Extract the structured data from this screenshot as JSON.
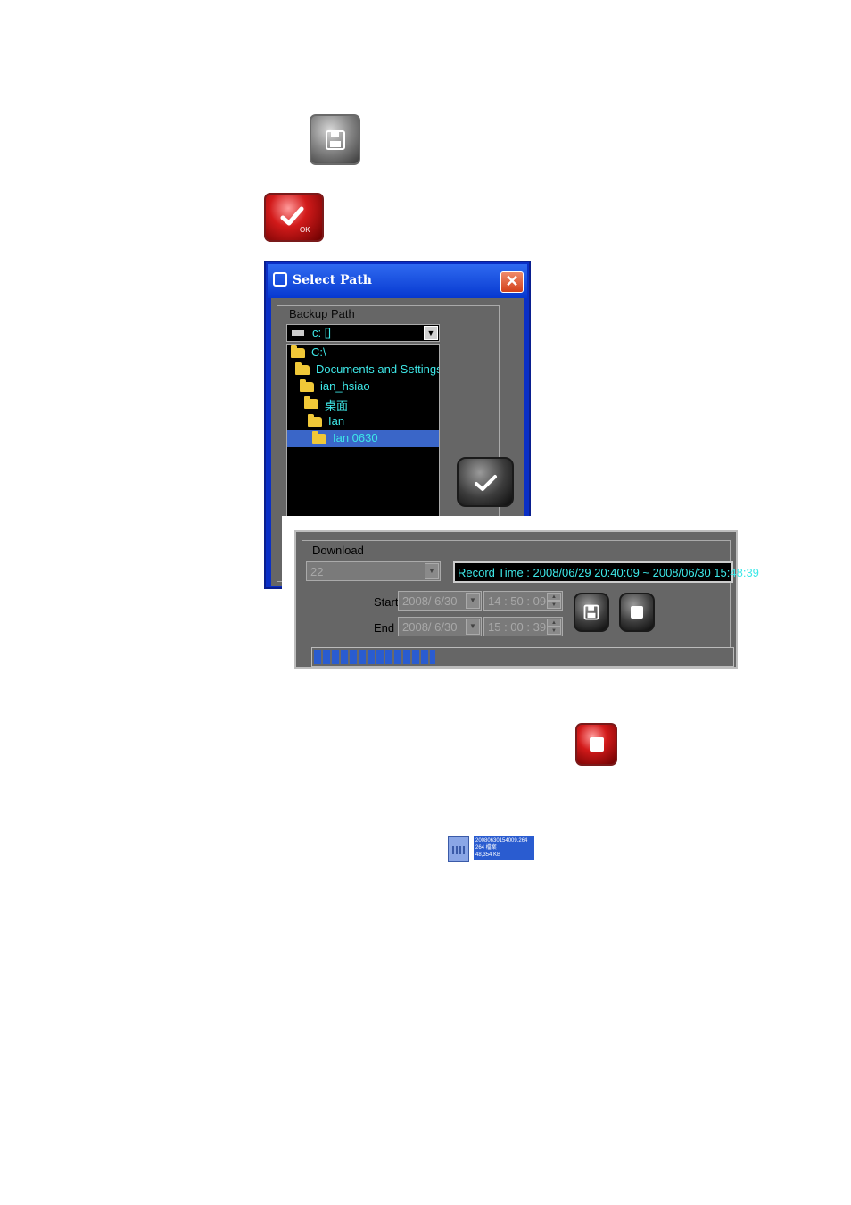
{
  "icons": {
    "save_button": "floppy-disk-icon",
    "ok_button": "checkmark-icon",
    "stop_button": "stop-square-icon"
  },
  "ok_badge": "OK",
  "select_path_dialog": {
    "title": "Select Path",
    "close_glyph": "✕",
    "group_label": "Backup Path",
    "drive_value": "c: []",
    "tree": [
      {
        "label": "C:\\",
        "depth": 0,
        "selected": false
      },
      {
        "label": "Documents and Settings",
        "depth": 1,
        "selected": false
      },
      {
        "label": "ian_hsiao",
        "depth": 2,
        "selected": false
      },
      {
        "label": "桌面",
        "depth": 3,
        "selected": false
      },
      {
        "label": "Ian",
        "depth": 4,
        "selected": false
      },
      {
        "label": "Ian 0630",
        "depth": 5,
        "selected": true
      }
    ]
  },
  "download_panel": {
    "group_label": "Download",
    "channel_value": "22",
    "record_time": "Record Time : 2008/06/29 20:40:09 ~ 2008/06/30 15:48:39",
    "start_label": "Start",
    "start_date": "2008/  6/30",
    "start_time": "14 : 50 : 09",
    "end_label": "End",
    "end_date": "2008/  6/30",
    "end_time": "15 : 00 : 39",
    "progress_fraction": 0.29
  },
  "file_chip": {
    "name": "20080630154009.264",
    "type": "264 檔案",
    "size": "48,354 KB"
  },
  "colors": {
    "accent_text": "#3ee8e8",
    "selection": "#3a66c8",
    "dialog_frame": "#0a2fc6",
    "stop_red": "#d21a1a"
  }
}
